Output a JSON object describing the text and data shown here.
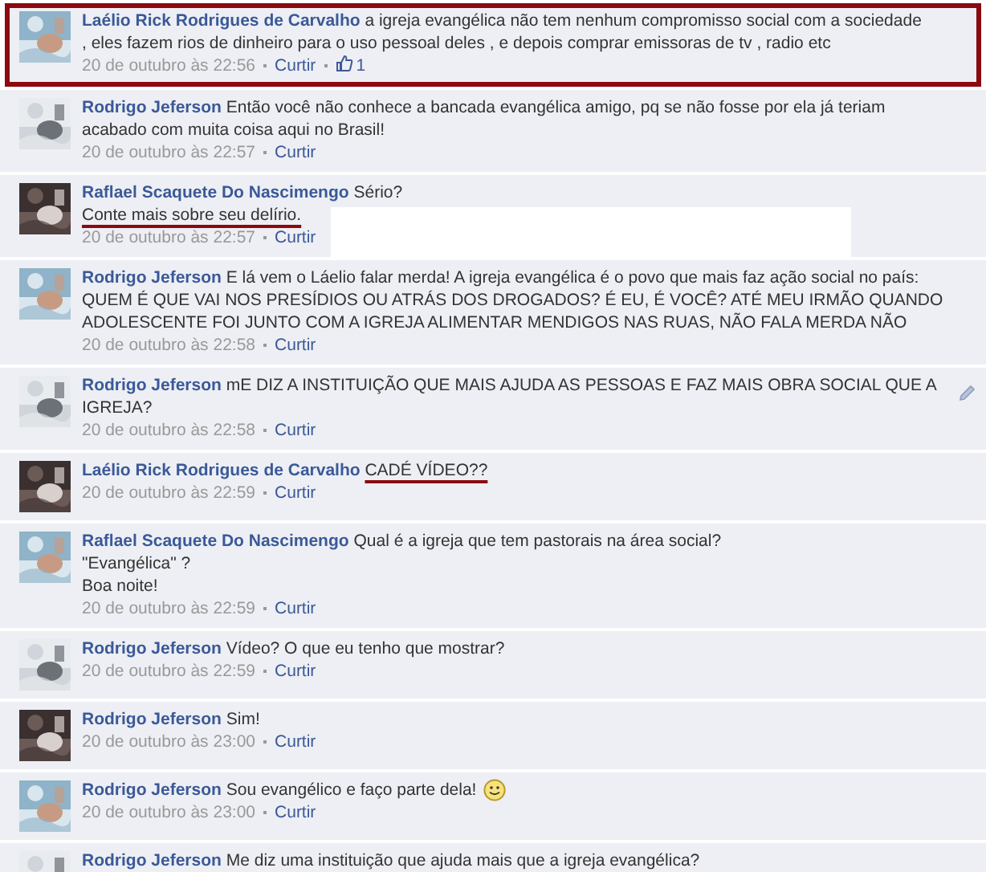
{
  "comments": [
    {
      "author": "Laélio Rick Rodrigues de Carvalho",
      "avatar": {
        "kind": "picture"
      },
      "highlighted": true,
      "editable": false,
      "redacted": false,
      "emoticon": false,
      "lines": [
        {
          "text": "a igreja evangélica não tem nenhum compromisso social com a sociedade",
          "underlined": false
        },
        {
          "text": ", eles fazem rios de dinheiro para o uso pessoal deles , e depois comprar emissoras de tv , radio etc",
          "underlined": false
        }
      ],
      "time": "20 de outubro às 22:56",
      "like_link": "Curtir",
      "likes": "1"
    },
    {
      "author": "Rodrigo Jeferson",
      "avatar": {
        "kind": "picture"
      },
      "highlighted": false,
      "editable": false,
      "redacted": false,
      "emoticon": false,
      "lines": [
        {
          "text": "Então você não conhece a bancada evangélica amigo, pq se não fosse por ela já teriam",
          "underlined": false
        },
        {
          "text": "acabado com muita coisa aqui no Brasil!",
          "underlined": false
        }
      ],
      "time": "20 de outubro às 22:57",
      "like_link": "Curtir"
    },
    {
      "author": "Raflael Scaquete Do Nascimengo",
      "avatar": {
        "kind": "picture"
      },
      "highlighted": false,
      "editable": false,
      "redacted": true,
      "emoticon": false,
      "lines": [
        {
          "text": "Sério?",
          "underlined": false
        },
        {
          "text": "Conte mais sobre seu delírio.",
          "underlined": true
        }
      ],
      "time": "20 de outubro às 22:57",
      "like_link": "Curtir"
    },
    {
      "author": "Rodrigo Jeferson",
      "avatar": {
        "kind": "picture"
      },
      "highlighted": false,
      "editable": false,
      "redacted": false,
      "emoticon": false,
      "lines": [
        {
          "text": "E lá vem o Láelio falar merda! A igreja evangélica é o povo que mais faz ação social no país:",
          "underlined": false
        },
        {
          "text": "QUEM É QUE VAI NOS PRESÍDIOS OU ATRÁS DOS DROGADOS? É EU, É VOCÊ? ATÉ MEU IRMÃO QUANDO",
          "underlined": false
        },
        {
          "text": "ADOLESCENTE FOI JUNTO COM A IGREJA ALIMENTAR MENDIGOS NAS RUAS, NÃO FALA MERDA NÃO",
          "underlined": false
        }
      ],
      "time": "20 de outubro às 22:58",
      "like_link": "Curtir"
    },
    {
      "author": "Rodrigo Jeferson",
      "avatar": {
        "kind": "picture"
      },
      "highlighted": false,
      "editable": true,
      "redacted": false,
      "emoticon": false,
      "lines": [
        {
          "text": "mE DIZ A INSTITUIÇÃO QUE MAIS AJUDA AS PESSOAS E FAZ MAIS OBRA SOCIAL QUE A",
          "underlined": false
        },
        {
          "text": "IGREJA?",
          "underlined": false
        }
      ],
      "time": "20 de outubro às 22:58",
      "like_link": "Curtir"
    },
    {
      "author": "Laélio Rick Rodrigues de Carvalho",
      "avatar": {
        "kind": "picture"
      },
      "highlighted": false,
      "editable": false,
      "redacted": false,
      "emoticon": false,
      "lines": [
        {
          "text": "CADÉ VÍDEO??",
          "underlined": true
        }
      ],
      "time": "20 de outubro às 22:59",
      "like_link": "Curtir"
    },
    {
      "author": "Raflael Scaquete Do Nascimengo",
      "avatar": {
        "kind": "picture"
      },
      "highlighted": false,
      "editable": false,
      "redacted": false,
      "emoticon": false,
      "lines": [
        {
          "text": "Qual é a igreja que tem pastorais na área social?",
          "underlined": false
        },
        {
          "text": "\"Evangélica\" ?",
          "underlined": false
        },
        {
          "text": "Boa noite!",
          "underlined": false
        }
      ],
      "time": "20 de outubro às 22:59",
      "like_link": "Curtir"
    },
    {
      "author": "Rodrigo Jeferson",
      "avatar": {
        "kind": "picture"
      },
      "highlighted": false,
      "editable": false,
      "redacted": false,
      "emoticon": false,
      "lines": [
        {
          "text": "Vídeo? O que eu tenho que mostrar?",
          "underlined": false
        }
      ],
      "time": "20 de outubro às 22:59",
      "like_link": "Curtir"
    },
    {
      "author": "Rodrigo Jeferson",
      "avatar": {
        "kind": "picture"
      },
      "highlighted": false,
      "editable": false,
      "redacted": false,
      "emoticon": false,
      "lines": [
        {
          "text": "Sim!",
          "underlined": false
        }
      ],
      "time": "20 de outubro às 23:00",
      "like_link": "Curtir"
    },
    {
      "author": "Rodrigo Jeferson",
      "avatar": {
        "kind": "picture"
      },
      "highlighted": false,
      "editable": false,
      "redacted": false,
      "emoticon": true,
      "lines": [
        {
          "text": "Sou evangélico e faço parte dela!",
          "underlined": false
        }
      ],
      "time": "20 de outubro às 23:00",
      "like_link": "Curtir"
    },
    {
      "author": "Rodrigo Jeferson",
      "avatar": {
        "kind": "picture"
      },
      "highlighted": false,
      "editable": false,
      "redacted": false,
      "emoticon": false,
      "lines": [
        {
          "text": "Me diz uma instituição que ajuda mais que a igreja evangélica?",
          "underlined": false
        }
      ]
    }
  ]
}
